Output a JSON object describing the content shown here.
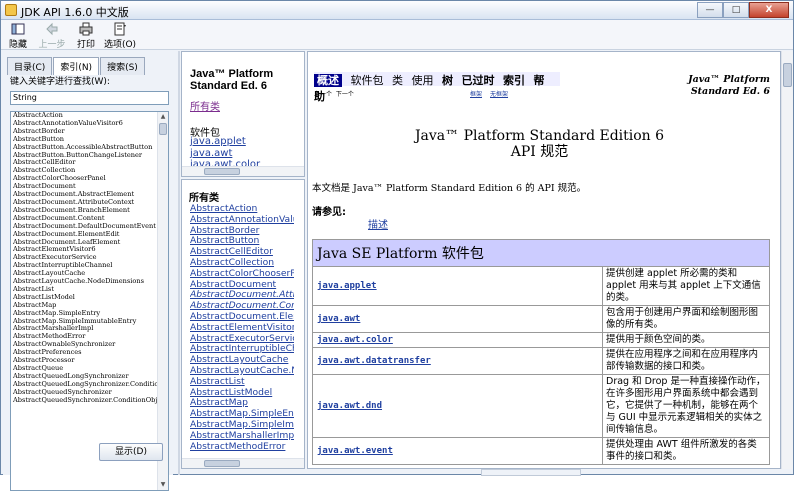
{
  "window": {
    "title": "JDK API 1.6.0 中文版",
    "min": "—",
    "max": "□",
    "close": "X"
  },
  "toolbar": {
    "hide": "隐藏",
    "back": "上一步",
    "print": "打印",
    "options": "选项(O)"
  },
  "left": {
    "tabs": [
      "目录(C)",
      "索引(N)",
      "搜索(S)"
    ],
    "find_label": "键入关键字进行查找(W):",
    "find_value": "String",
    "index_items": [
      "AbstractAction",
      "AbstractAnnotationValueVisitor6",
      "AbstractBorder",
      "AbstractButton",
      "AbstractButton.AccessibleAbstractButton",
      "AbstractButton.ButtonChangeListener",
      "AbstractCellEditor",
      "AbstractCollection",
      "AbstractColorChooserPanel",
      "AbstractDocument",
      "AbstractDocument.AbstractElement",
      "AbstractDocument.AttributeContext",
      "AbstractDocument.BranchElement",
      "AbstractDocument.Content",
      "AbstractDocument.DefaultDocumentEvent",
      "AbstractDocument.ElementEdit",
      "AbstractDocument.LeafElement",
      "AbstractElementVisitor6",
      "AbstractExecutorService",
      "AbstractInterruptibleChannel",
      "AbstractLayoutCache",
      "AbstractLayoutCache.NodeDimensions",
      "AbstractList",
      "AbstractListModel",
      "AbstractMap",
      "AbstractMap.SimpleEntry",
      "AbstractMap.SimpleImmutableEntry",
      "AbstractMarshallerImpl",
      "AbstractMethodError",
      "AbstractOwnableSynchronizer",
      "AbstractPreferences",
      "AbstractProcessor",
      "AbstractQueue",
      "AbstractQueuedLongSynchronizer",
      "AbstractQueuedLongSynchronizer.ConditionObje",
      "AbstractQueuedSynchronizer",
      "AbstractQueuedSynchronizer.ConditionObject"
    ],
    "display_button": "显示(D)"
  },
  "package_frame": {
    "heading_line1": "Java™ Platform",
    "heading_line2": "Standard Ed. 6",
    "all_classes": "所有类",
    "packages_label": "软件包",
    "packages": [
      "java.applet",
      "java.awt",
      "java.awt.color"
    ]
  },
  "class_frame": {
    "heading": "所有类",
    "classes": [
      {
        "name": "AbstractAction",
        "italic": false
      },
      {
        "name": "AbstractAnnotationValu",
        "italic": false
      },
      {
        "name": "AbstractBorder",
        "italic": false
      },
      {
        "name": "AbstractButton",
        "italic": false
      },
      {
        "name": "AbstractCellEditor",
        "italic": false
      },
      {
        "name": "AbstractCollection",
        "italic": false
      },
      {
        "name": "AbstractColorChooserP",
        "italic": false
      },
      {
        "name": "AbstractDocument",
        "italic": false
      },
      {
        "name": "AbstractDocument.Attri",
        "italic": true
      },
      {
        "name": "AbstractDocument.Con",
        "italic": true
      },
      {
        "name": "AbstractDocument.Elen",
        "italic": false
      },
      {
        "name": "AbstractElementVisitor",
        "italic": false
      },
      {
        "name": "AbstractExecutorServic",
        "italic": false
      },
      {
        "name": "AbstractInterruptibleCh",
        "italic": false
      },
      {
        "name": "AbstractLayoutCache",
        "italic": false
      },
      {
        "name": "AbstractLayoutCache.N",
        "italic": false
      },
      {
        "name": "AbstractList",
        "italic": false
      },
      {
        "name": "AbstractListModel",
        "italic": false
      },
      {
        "name": "AbstractMap",
        "italic": false
      },
      {
        "name": "AbstractMap.SimpleEnt",
        "italic": false
      },
      {
        "name": "AbstractMap.SimpleImn",
        "italic": false
      },
      {
        "name": "AbstractMarshallerImpl",
        "italic": false
      },
      {
        "name": "AbstractMethodError",
        "italic": false
      }
    ]
  },
  "main": {
    "nav": {
      "overview": "概述",
      "package": "软件包",
      "class": "类",
      "use": "使用",
      "tree": "树",
      "deprecated": "已过时",
      "index": "索引",
      "help": "帮助"
    },
    "prev": "上一个",
    "next": "下一个",
    "frames": "框架",
    "noframes": "无框架",
    "brand_line1": "Java™ Platform",
    "brand_line2": "Standard Ed. 6",
    "title_line1": "Java™ Platform Standard Edition 6",
    "title_line2": "API 规范",
    "intro": "本文档是 Java™ Platform Standard Edition 6 的 API 规范。",
    "see_also": "请参见:",
    "overview_link": "描述",
    "table_header": "Java SE Platform 软件包",
    "packages": [
      {
        "name": "java.applet",
        "desc": "提供创建 applet 所必需的类和 applet 用来与其 applet 上下文通信的类。"
      },
      {
        "name": "java.awt",
        "desc": "包含用于创建用户界面和绘制图形图像的所有类。"
      },
      {
        "name": "java.awt.color",
        "desc": "提供用于颜色空间的类。"
      },
      {
        "name": "java.awt.datatransfer",
        "desc": "提供在应用程序之间和在应用程序内部传输数据的接口和类。"
      },
      {
        "name": "java.awt.dnd",
        "desc": "Drag 和 Drop 是一种直接操作动作，在许多图形用户界面系统中都会遇到它，它提供了一种机制，能够在两个与 GUI 中显示元素逻辑相关的实体之间传输信息。"
      },
      {
        "name": "java.awt.event",
        "desc": "提供处理由 AWT 组件所激发的各类事件的接口和类。"
      }
    ]
  }
}
